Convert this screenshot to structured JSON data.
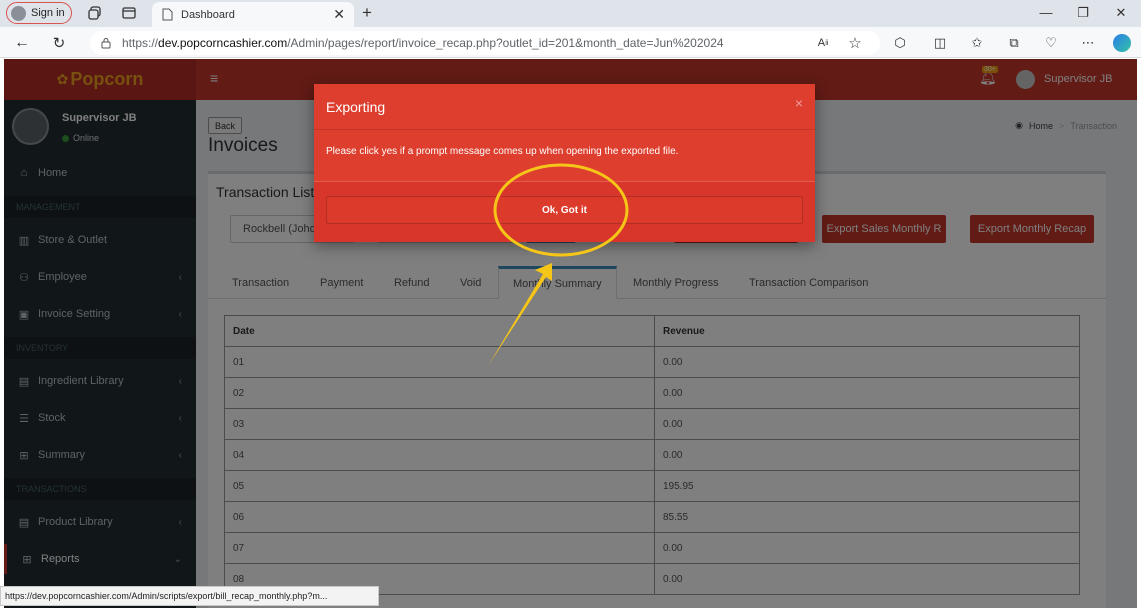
{
  "browser": {
    "sign_in_label": "Sign in",
    "tab_title": "Dashboard",
    "url_prefix": "https://",
    "url_host": "dev.popcorncashier.com",
    "url_path": "/Admin/pages/report/invoice_recap.php?outlet_id=201&month_date=Jun%202024",
    "status_url": "https://dev.popcorncashier.com/Admin/scripts/export/bill_recap_monthly.php?m..."
  },
  "app": {
    "logo_text": "Popcorn",
    "notification_badge": "30+",
    "header_user": "Supervisor JB"
  },
  "sidebar": {
    "user_name": "Supervisor JB",
    "user_status": "Online",
    "items": [
      {
        "label": "Home",
        "icon": "home-icon"
      },
      {
        "header": "MANAGEMENT"
      },
      {
        "label": "Store & Outlet",
        "icon": "bank-icon"
      },
      {
        "label": "Employee",
        "icon": "users-icon"
      },
      {
        "label": "Invoice Setting",
        "icon": "money-icon"
      },
      {
        "header": "INVENTORY"
      },
      {
        "label": "Ingredient Library",
        "icon": "book-icon"
      },
      {
        "label": "Stock",
        "icon": "database-icon"
      },
      {
        "label": "Summary",
        "icon": "table-icon"
      },
      {
        "header": "TRANSACTIONS"
      },
      {
        "label": "Product Library",
        "icon": "book-icon"
      },
      {
        "label": "Reports",
        "icon": "table-icon"
      }
    ]
  },
  "page": {
    "back_label": "Back",
    "title": "Invoices",
    "breadcrumb_home": "Home",
    "breadcrumb_current": "Transaction",
    "box_title": "Transaction List",
    "outlet_select": "Rockbell (Johor",
    "export_sales_label": "Export Sales Monthly R",
    "export_recap_label": "Export Monthly Recap",
    "tabs": [
      "Transaction",
      "Payment",
      "Refund",
      "Void",
      "Monthly Summary",
      "Monthly Progress",
      "Transaction Comparison"
    ],
    "active_tab": "Monthly Summary",
    "table": {
      "headers": [
        "Date",
        "Revenue"
      ],
      "rows": [
        [
          "01",
          "0.00"
        ],
        [
          "02",
          "0.00"
        ],
        [
          "03",
          "0.00"
        ],
        [
          "04",
          "0.00"
        ],
        [
          "05",
          "195.95"
        ],
        [
          "06",
          "85.55"
        ],
        [
          "07",
          "0.00"
        ],
        [
          "08",
          "0.00"
        ]
      ]
    }
  },
  "modal": {
    "title": "Exporting",
    "message": "Please click yes if a prompt message comes up when opening the exported file.",
    "ok_label": "Ok, Got it"
  },
  "colors": {
    "brand_red": "#c4362a",
    "modal_red": "#dd3e2e",
    "sidebar_bg": "#222d32",
    "annotation_yellow": "#f5c518"
  }
}
